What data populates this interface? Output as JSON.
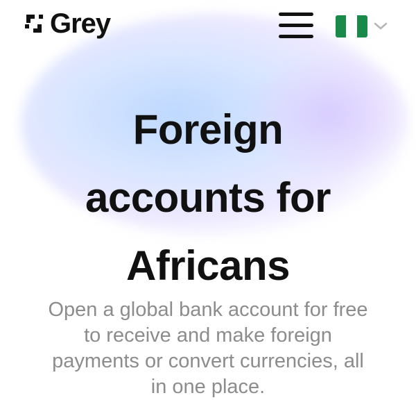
{
  "brand": {
    "name": "Grey",
    "logo_icon": "grey-logo-mark"
  },
  "header": {
    "menu_icon": "hamburger-menu-icon",
    "country": {
      "flag_icon": "nigeria-flag-icon",
      "chevron_icon": "chevron-down-icon"
    }
  },
  "hero": {
    "title_lines": [
      "Foreign",
      "accounts for",
      "Africans"
    ],
    "subtitle": "Open a global bank account for free to receive and make foreign payments or convert currencies, all in one place."
  },
  "colors": {
    "text_primary": "#111111",
    "text_secondary": "#8c8c8c",
    "flag_green": "#1a8a4a",
    "flag_white": "#ffffff",
    "glow_blue": "#bad6ff",
    "glow_purple": "#d6c6ff"
  }
}
